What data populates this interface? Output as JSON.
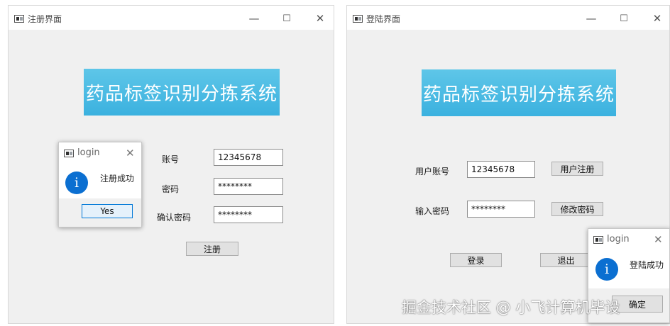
{
  "register_window": {
    "title": "注册界面",
    "banner": "药品标签识别分拣系统",
    "account_label": "账号",
    "account_value": "12345678",
    "password_label": "密码",
    "password_value": "********",
    "confirm_label": "确认密码",
    "confirm_value": "********",
    "register_button": "注册"
  },
  "register_dialog": {
    "title": "login",
    "message": "注册成功",
    "yes_button": "Yes"
  },
  "login_window": {
    "title": "登陆界面",
    "banner": "药品标签识别分拣系统",
    "account_label": "用户账号",
    "account_value": "12345678",
    "password_label": "输入密码",
    "password_value": "********",
    "register_button": "用户注册",
    "change_password_button": "修改密码",
    "login_button": "登录",
    "exit_button": "退出"
  },
  "login_dialog": {
    "title": "login",
    "message": "登陆成功",
    "ok_button": "确定"
  },
  "window_controls": {
    "minimize": "—",
    "maximize": "☐",
    "close": "✕"
  },
  "watermark": "掘金技术社区 @ 小飞计算机毕设",
  "colors": {
    "banner": "#3bb1df",
    "info_icon": "#0b6fd1",
    "window_bg": "#f0f0f0"
  }
}
